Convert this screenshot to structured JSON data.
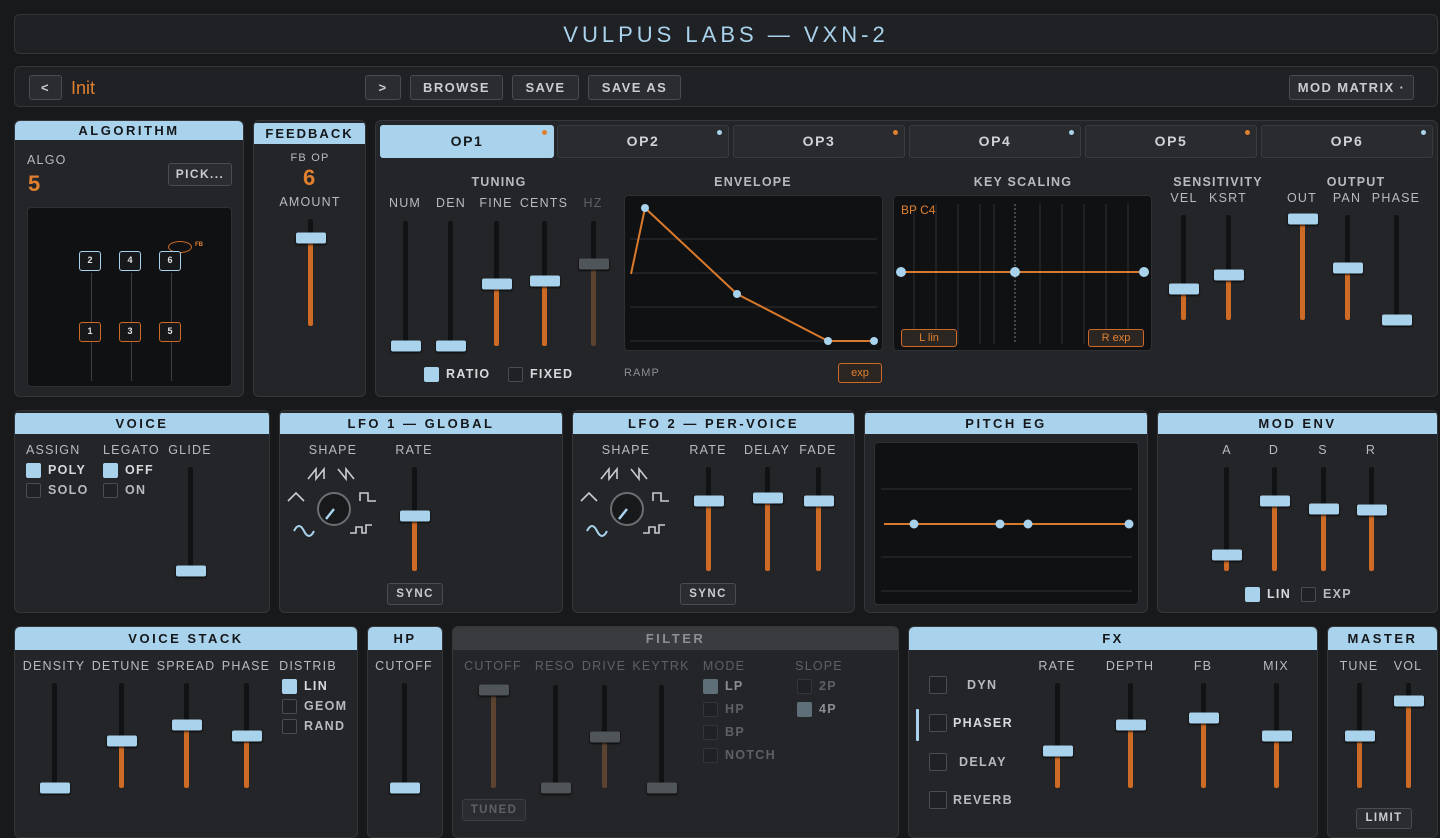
{
  "title": "VULPUS LABS — VXN-2",
  "preset_bar": {
    "prev": "<",
    "name": "Init",
    "next": ">",
    "browse": "BROWSE",
    "save": "SAVE",
    "save_as": "SAVE AS",
    "mod_matrix": "MOD MATRIX ·"
  },
  "algorithm": {
    "header": "ALGORITHM",
    "algo_label": "ALGO",
    "algo_value": "5",
    "pick": "PICK...",
    "fb_tag": "FB",
    "nodes": [
      "2",
      "4",
      "6",
      "1",
      "3",
      "5"
    ]
  },
  "feedback": {
    "header": "FEEDBACK",
    "fb_op_label": "FB OP",
    "fb_op_value": "6",
    "amount_label": "AMOUNT",
    "amount": 0.82
  },
  "ops": {
    "tabs": [
      {
        "label": "OP1",
        "dot": "#e0802f"
      },
      {
        "label": "OP2",
        "dot": "#a9d3ec"
      },
      {
        "label": "OP3",
        "dot": "#e0802f"
      },
      {
        "label": "OP4",
        "dot": "#a9d3ec"
      },
      {
        "label": "OP5",
        "dot": "#e0802f"
      },
      {
        "label": "OP6",
        "dot": "#a9d3ec"
      }
    ],
    "active": "OP1"
  },
  "tuning": {
    "header": "TUNING",
    "num": "NUM",
    "den": "DEN",
    "fine": "FINE",
    "cents": "CENTS",
    "hz": "HZ",
    "ratio": "RATIO",
    "fixed": "FIXED",
    "values": {
      "num": 0.0,
      "den": 0.0,
      "fine": 0.5,
      "cents": 0.52,
      "hz": 0.66
    }
  },
  "envelope": {
    "header": "ENVELOPE",
    "ramp": "RAMP",
    "curve": "exp"
  },
  "key_scaling": {
    "header": "KEY SCALING",
    "bp": "BP C4",
    "left": "L lin",
    "right": "R exp"
  },
  "sensitivity": {
    "header": "SENSITIVITY",
    "vel": "VEL",
    "ksrt": "KSRT",
    "values": {
      "vel": 0.3,
      "ksrt": 0.43
    }
  },
  "output": {
    "header": "OUTPUT",
    "out": "OUT",
    "pan": "PAN",
    "phase": "PHASE",
    "values": {
      "out": 0.96,
      "pan": 0.5,
      "phase": 0.0
    }
  },
  "voice": {
    "header": "VOICE",
    "assign": "ASSIGN",
    "legato": "LEGATO",
    "glide": "GLIDE",
    "poly": "POLY",
    "solo": "SOLO",
    "off": "OFF",
    "on": "ON",
    "glide_value": 0.0
  },
  "lfo1": {
    "header": "LFO 1 — GLOBAL",
    "shape": "SHAPE",
    "rate": "RATE",
    "sync": "SYNC",
    "rate_value": 0.53
  },
  "lfo2": {
    "header": "LFO 2 — PER-VOICE",
    "shape": "SHAPE",
    "rate": "RATE",
    "delay": "DELAY",
    "fade": "FADE",
    "sync": "SYNC",
    "values": {
      "rate": 0.67,
      "delay": 0.7,
      "fade": 0.67
    }
  },
  "pitch_eg": {
    "header": "PITCH EG"
  },
  "mod_env": {
    "header": "MOD ENV",
    "a": "A",
    "d": "D",
    "s": "S",
    "r": "R",
    "lin": "LIN",
    "exp": "EXP",
    "values": {
      "a": 0.15,
      "d": 0.67,
      "s": 0.6,
      "r": 0.59
    }
  },
  "voice_stack": {
    "header": "VOICE STACK",
    "density": "DENSITY",
    "detune": "DETUNE",
    "spread": "SPREAD",
    "phase": "PHASE",
    "distrib": "DISTRIB",
    "lin": "LIN",
    "geom": "GEOM",
    "rand": "RAND",
    "values": {
      "density": 0.0,
      "detune": 0.45,
      "spread": 0.6,
      "phase": 0.5
    }
  },
  "hp": {
    "header": "HP",
    "cutoff": "CUTOFF",
    "cutoff_value": 0.0
  },
  "filter": {
    "header": "FILTER",
    "cutoff": "CUTOFF",
    "reso": "RESO",
    "drive": "DRIVE",
    "keytrk": "KEYTRK",
    "mode": "MODE",
    "slope": "SLOPE",
    "lp": "LP",
    "hp": "HP",
    "bp": "BP",
    "notch": "NOTCH",
    "s2p": "2P",
    "s4p": "4P",
    "tuned": "TUNED",
    "values": {
      "cutoff": 0.95,
      "reso": 0.0,
      "drive": 0.5,
      "keytrk": 0.0
    }
  },
  "fx": {
    "header": "FX",
    "dyn": "DYN",
    "phaser": "PHASER",
    "delay": "DELAY",
    "reverb": "REVERB",
    "rate": "RATE",
    "depth": "DEPTH",
    "fb": "FB",
    "mix": "MIX",
    "values": {
      "rate": 0.35,
      "depth": 0.6,
      "fb": 0.67,
      "mix": 0.5
    }
  },
  "master": {
    "header": "MASTER",
    "tune": "TUNE",
    "vol": "VOL",
    "limit": "LIMIT",
    "values": {
      "tune": 0.5,
      "vol": 0.83
    }
  }
}
